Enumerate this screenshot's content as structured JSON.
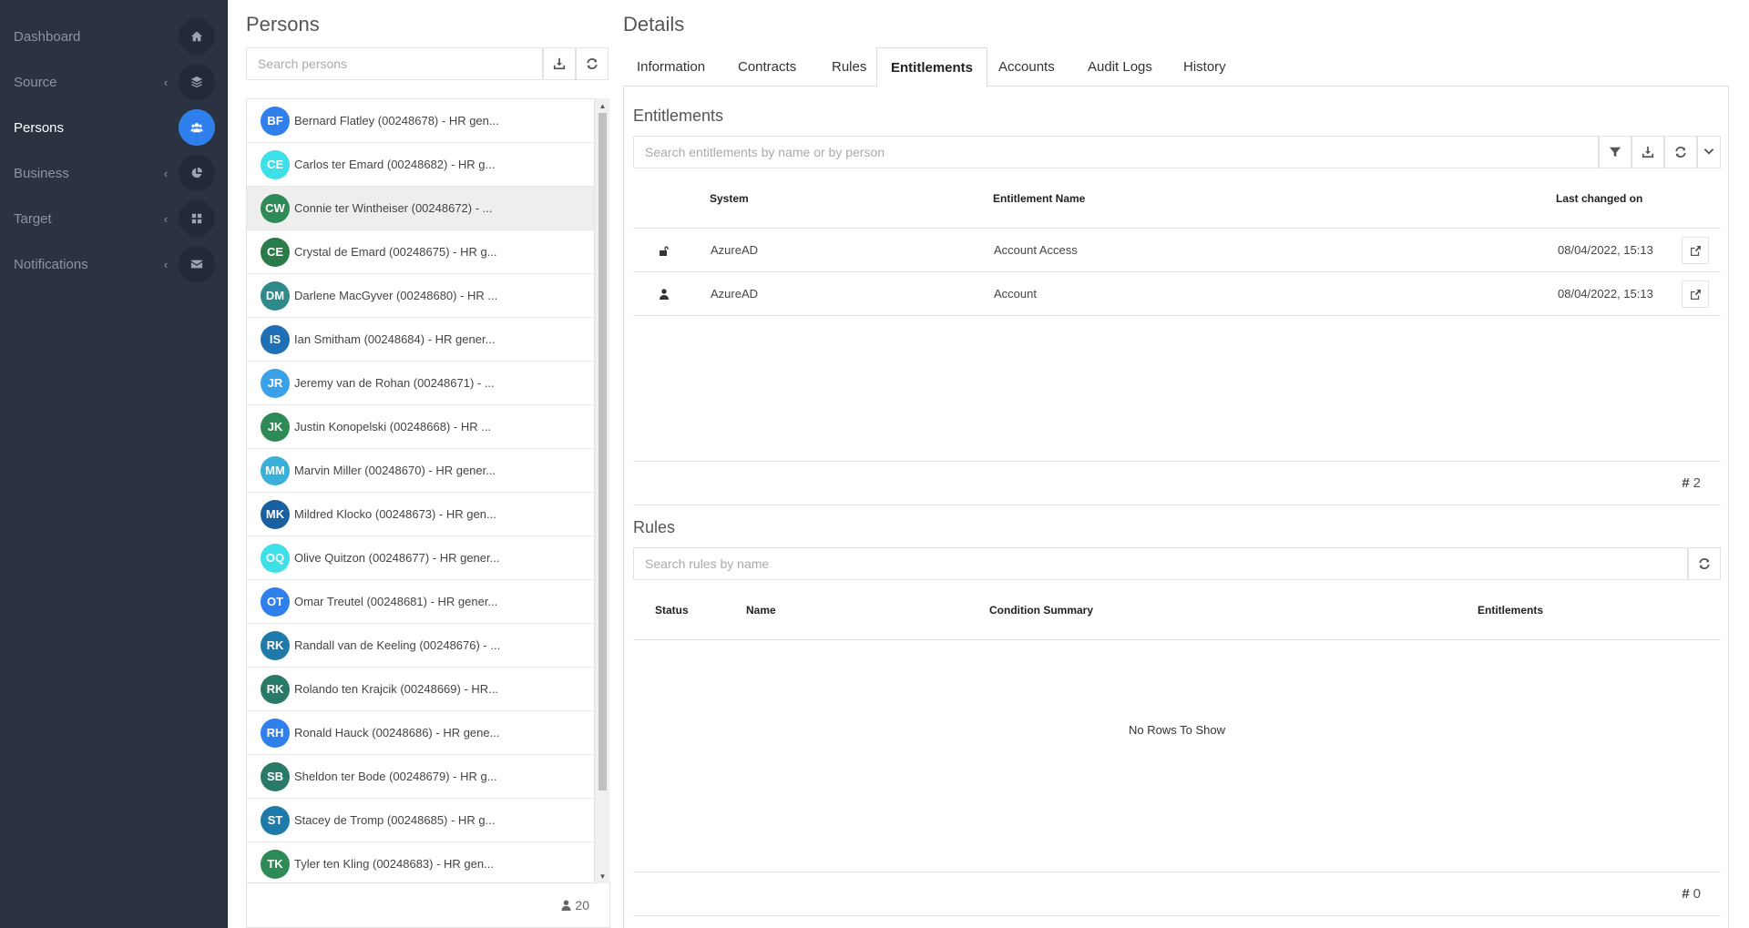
{
  "sidebar": {
    "items": [
      {
        "label": "Dashboard",
        "icon": "home-icon"
      },
      {
        "label": "Source",
        "icon": "layers-icon"
      },
      {
        "label": "Persons",
        "icon": "users-icon"
      },
      {
        "label": "Business",
        "icon": "pie-chart-icon"
      },
      {
        "label": "Target",
        "icon": "grid-icon"
      },
      {
        "label": "Notifications",
        "icon": "envelope-icon"
      }
    ]
  },
  "persons": {
    "title": "Persons",
    "search_placeholder": "Search persons",
    "count": "20",
    "list": [
      {
        "initials": "BF",
        "name": "Bernard Flatley (00248678) - HR gen...",
        "color": "#2f80ed"
      },
      {
        "initials": "CE",
        "name": "Carlos ter Emard (00248682) - HR g...",
        "color": "#3ee0e8"
      },
      {
        "initials": "CW",
        "name": "Connie ter Wintheiser (00248672) - ...",
        "color": "#2e8b57"
      },
      {
        "initials": "CE",
        "name": "Crystal de Emard (00248675) - HR g...",
        "color": "#2a7a4a"
      },
      {
        "initials": "DM",
        "name": "Darlene MacGyver (00248680) - HR ...",
        "color": "#2f8a8a"
      },
      {
        "initials": "IS",
        "name": "Ian Smitham (00248684) - HR gener...",
        "color": "#1e6fb5"
      },
      {
        "initials": "JR",
        "name": "Jeremy van de Rohan (00248671) - ...",
        "color": "#3aa0e8"
      },
      {
        "initials": "JK",
        "name": "Justin Konopelski (00248668) - HR ...",
        "color": "#2e8b57"
      },
      {
        "initials": "MM",
        "name": "Marvin Miller (00248670) - HR gener...",
        "color": "#3ab0d8"
      },
      {
        "initials": "MK",
        "name": "Mildred Klocko (00248673) - HR gen...",
        "color": "#1a5fa0"
      },
      {
        "initials": "OQ",
        "name": "Olive Quitzon (00248677) - HR gener...",
        "color": "#3ee0e8"
      },
      {
        "initials": "OT",
        "name": "Omar Treutel (00248681) - HR gener...",
        "color": "#2f80ed"
      },
      {
        "initials": "RK",
        "name": "Randall van de Keeling (00248676) - ...",
        "color": "#1e7aa8"
      },
      {
        "initials": "RK",
        "name": "Rolando ten Krajcik (00248669) - HR...",
        "color": "#2a7a68"
      },
      {
        "initials": "RH",
        "name": "Ronald Hauck (00248686) - HR gene...",
        "color": "#2f80ed"
      },
      {
        "initials": "SB",
        "name": "Sheldon ter Bode (00248679) - HR g...",
        "color": "#2a7a68"
      },
      {
        "initials": "ST",
        "name": "Stacey de Tromp (00248685) - HR g...",
        "color": "#1e7aa8"
      },
      {
        "initials": "TK",
        "name": "Tyler ten Kling (00248683) - HR gen...",
        "color": "#2e8b57"
      }
    ]
  },
  "details": {
    "title": "Details",
    "tabs": [
      "Information",
      "Contracts",
      "Rules",
      "Entitlements",
      "Accounts",
      "Audit Logs",
      "History"
    ],
    "active_tab": "Entitlements"
  },
  "entitlements": {
    "title": "Entitlements",
    "search_placeholder": "Search entitlements by name or by person",
    "columns": [
      "System",
      "Entitlement Name",
      "Last changed on"
    ],
    "rows": [
      {
        "icon": "unlock-icon",
        "system": "AzureAD",
        "name": "Account Access",
        "changed": "08/04/2022, 15:13"
      },
      {
        "icon": "user-icon",
        "system": "AzureAD",
        "name": "Account",
        "changed": "08/04/2022, 15:13"
      }
    ],
    "count": "2"
  },
  "rules": {
    "title": "Rules",
    "search_placeholder": "Search rules by name",
    "columns": [
      "Status",
      "Name",
      "Condition Summary",
      "Entitlements"
    ],
    "empty_text": "No Rows To Show",
    "count": "0"
  }
}
